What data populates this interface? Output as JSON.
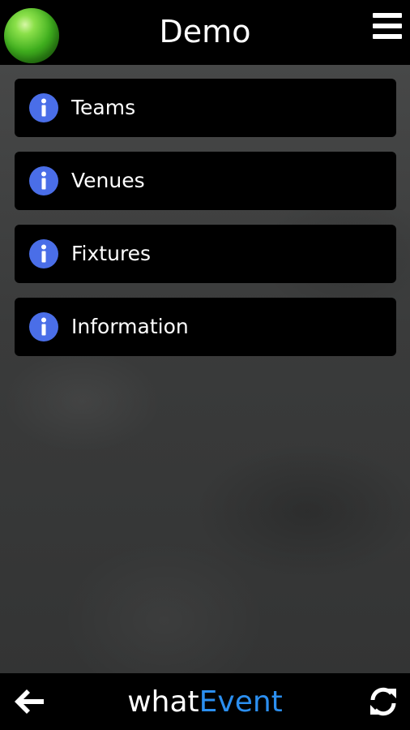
{
  "header": {
    "title": "Demo",
    "status_color": "#3fae1e",
    "status_icon": "green-status-orb",
    "menu_icon": "hamburger-menu-icon"
  },
  "menu": {
    "item_icon": "info-icon",
    "icon_color": "#4a6ee8",
    "items": [
      {
        "label": "Teams"
      },
      {
        "label": "Venues"
      },
      {
        "label": "Fixtures"
      },
      {
        "label": "Information"
      }
    ]
  },
  "footer": {
    "brand_part1": "what",
    "brand_part2": "Event",
    "brand_accent_color": "#2b8ff0",
    "back_icon": "arrow-left-icon",
    "refresh_icon": "refresh-icon"
  }
}
